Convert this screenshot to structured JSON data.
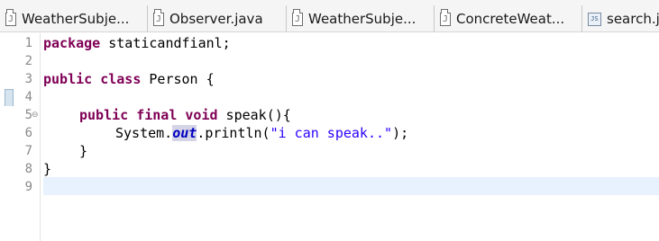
{
  "tabs": [
    {
      "label": "WeatherSubje...",
      "icon": "java-file-icon"
    },
    {
      "label": "Observer.java",
      "icon": "java-file-icon"
    },
    {
      "label": "WeatherSubje...",
      "icon": "java-file-icon"
    },
    {
      "label": "ConcreteWeat...",
      "icon": "java-file-icon"
    },
    {
      "label": "search.js",
      "icon": "js-file-icon"
    }
  ],
  "editor": {
    "line_numbers": [
      "1",
      "2",
      "3",
      "4",
      "5",
      "6",
      "7",
      "8",
      "9"
    ],
    "fold_marker": "⊖",
    "code": {
      "l1_kw": "package",
      "l1_rest": " staticandfianl;",
      "l3_kw1": "public",
      "l3_kw2": "class",
      "l3_rest": " Person {",
      "l5_kw1": "public",
      "l5_kw2": "final",
      "l5_kw3": "void",
      "l5_rest": " speak(){",
      "l6_pre": "System.",
      "l6_field": "out",
      "l6_mid": ".println(",
      "l6_str": "\"i can speak..\"",
      "l6_end": ");",
      "l7": "}",
      "l8": "}"
    }
  }
}
